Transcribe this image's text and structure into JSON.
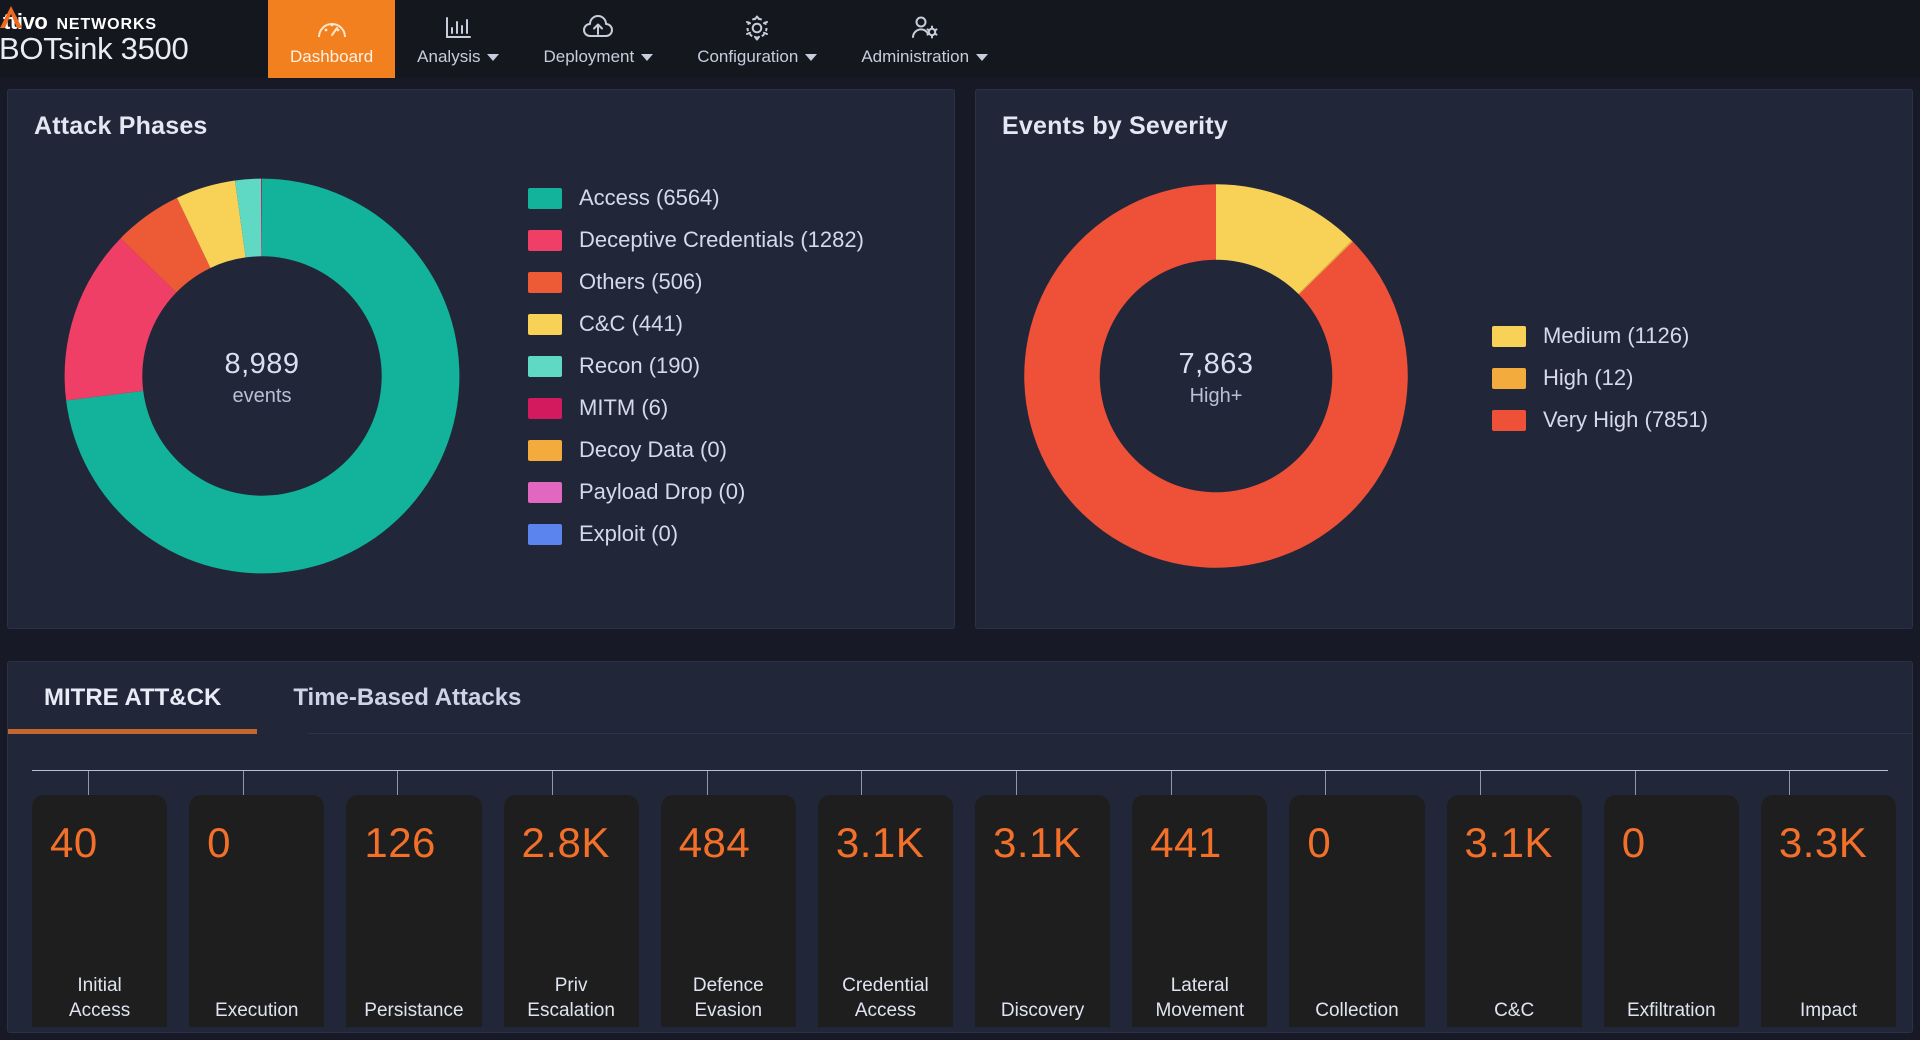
{
  "header": {
    "brand": {
      "logo_icon": "attivo-a-mark-icon",
      "name_part1": "A",
      "name_part2": "ttivo",
      "name_part3": "NETWORKS",
      "model": "BOTsink 3500"
    },
    "nav": [
      {
        "label": "Dashboard",
        "icon": "gauge-icon",
        "active": true,
        "caret": false
      },
      {
        "label": "Analysis",
        "icon": "bar-chart-icon",
        "active": false,
        "caret": true
      },
      {
        "label": "Deployment",
        "icon": "cloud-upload-icon",
        "active": false,
        "caret": true
      },
      {
        "label": "Configuration",
        "icon": "gear-icon",
        "active": false,
        "caret": true
      },
      {
        "label": "Administration",
        "icon": "user-gear-icon",
        "active": false,
        "caret": true
      }
    ]
  },
  "cards": {
    "attack_phases": {
      "title": "Attack Phases"
    },
    "events_by_severity": {
      "title": "Events by Severity"
    }
  },
  "bottom": {
    "tabs": [
      {
        "label": "MITRE ATT&CK",
        "active": true
      },
      {
        "label": "Time-Based Attacks",
        "active": false
      }
    ]
  },
  "chart_data": [
    {
      "type": "pie",
      "variant": "donut",
      "title": "Attack Phases",
      "center_value": "8,989",
      "center_label": "events",
      "total": 8989,
      "legend_position": "right",
      "categories": [
        "Access",
        "Deceptive Credentials",
        "Others",
        "C&C",
        "Recon",
        "MITM",
        "Decoy Data",
        "Payload Drop",
        "Exploit"
      ],
      "values": [
        6564,
        1282,
        506,
        441,
        190,
        6,
        0,
        0,
        0
      ],
      "colors": [
        "#12b39a",
        "#ef3f67",
        "#ed5a36",
        "#f7d257",
        "#5fd8c4",
        "#d41a5e",
        "#f2ab3c",
        "#e167c0",
        "#5c84ee"
      ],
      "legend_entries": [
        {
          "label": "Access (6564)",
          "color": "#12b39a",
          "value": 6564
        },
        {
          "label": "Deceptive Credentials (1282)",
          "color": "#ef3f67",
          "value": 1282
        },
        {
          "label": "Others (506)",
          "color": "#ed5a36",
          "value": 506
        },
        {
          "label": "C&C (441)",
          "color": "#f7d257",
          "value": 441
        },
        {
          "label": "Recon (190)",
          "color": "#5fd8c4",
          "value": 190
        },
        {
          "label": "MITM (6)",
          "color": "#d41a5e",
          "value": 6
        },
        {
          "label": "Decoy Data (0)",
          "color": "#f2ab3c",
          "value": 0
        },
        {
          "label": "Payload Drop (0)",
          "color": "#e167c0",
          "value": 0
        },
        {
          "label": "Exploit (0)",
          "color": "#5c84ee",
          "value": 0
        }
      ]
    },
    {
      "type": "pie",
      "variant": "donut",
      "title": "Events by Severity",
      "center_value": "7,863",
      "center_label": "High+",
      "total": 8989,
      "legend_position": "right",
      "categories": [
        "Medium",
        "High",
        "Very High"
      ],
      "values": [
        1126,
        12,
        7851
      ],
      "colors": [
        "#f7d257",
        "#f2ab3c",
        "#ef5138"
      ],
      "legend_entries": [
        {
          "label": "Medium (1126)",
          "color": "#f7d257",
          "value": 1126
        },
        {
          "label": "High (12)",
          "color": "#f2ab3c",
          "value": 12
        },
        {
          "label": "Very High (7851)",
          "color": "#ef5138",
          "value": 7851
        }
      ]
    },
    {
      "type": "bar",
      "variant": "tiles",
      "title": "MITRE ATT&CK",
      "categories": [
        "Initial Access",
        "Execution",
        "Persistance",
        "Priv Escalation",
        "Defence Evasion",
        "Credential Access",
        "Discovery",
        "Lateral Movement",
        "Collection",
        "C&C",
        "Exfiltration",
        "Impact"
      ],
      "value_labels": [
        "40",
        "0",
        "126",
        "2.8K",
        "484",
        "3.1K",
        "3.1K",
        "441",
        "0",
        "3.1K",
        "0",
        "3.3K"
      ],
      "values": [
        40,
        0,
        126,
        2800,
        484,
        3100,
        3100,
        441,
        0,
        3100,
        0,
        3300
      ],
      "tiles": [
        {
          "value": "40",
          "label_line1": "Initial",
          "label_line2": "Access"
        },
        {
          "value": "0",
          "label_line1": "Execution",
          "label_line2": ""
        },
        {
          "value": "126",
          "label_line1": "Persistance",
          "label_line2": ""
        },
        {
          "value": "2.8K",
          "label_line1": "Priv",
          "label_line2": "Escalation"
        },
        {
          "value": "484",
          "label_line1": "Defence",
          "label_line2": "Evasion"
        },
        {
          "value": "3.1K",
          "label_line1": "Credential",
          "label_line2": "Access"
        },
        {
          "value": "3.1K",
          "label_line1": "Discovery",
          "label_line2": ""
        },
        {
          "value": "441",
          "label_line1": "Lateral",
          "label_line2": "Movement"
        },
        {
          "value": "0",
          "label_line1": "Collection",
          "label_line2": ""
        },
        {
          "value": "3.1K",
          "label_line1": "C&C",
          "label_line2": ""
        },
        {
          "value": "0",
          "label_line1": "Exfiltration",
          "label_line2": ""
        },
        {
          "value": "3.3K",
          "label_line1": "Impact",
          "label_line2": ""
        }
      ]
    }
  ],
  "theme": {
    "accent": "#f2801f",
    "tile_value_color": "#f2702a",
    "card_bg": "#222639",
    "page_bg": "#171a26",
    "header_bg": "#15171f",
    "tab_underline": "#c4672e"
  }
}
